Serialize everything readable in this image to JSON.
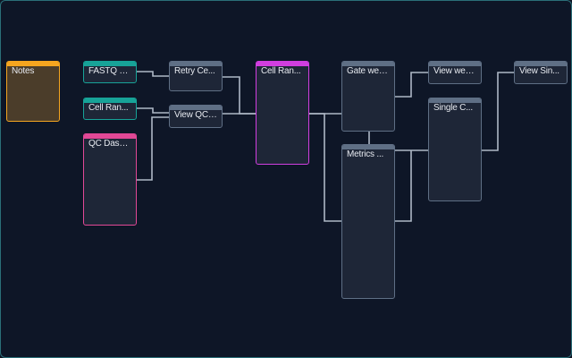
{
  "colors": {
    "background": "#0e1627",
    "canvas_border": "#2b6f78",
    "node_body": "#1e2637",
    "wire": "#aeb8c6"
  },
  "nodes": [
    {
      "id": "notes",
      "title": "Notes",
      "color": "#f5a51f",
      "kind": "note"
    },
    {
      "id": "fastq",
      "title": "FASTQ Di...",
      "color": "#17a398",
      "kind": "teal"
    },
    {
      "id": "cellran1",
      "title": "Cell Ran...",
      "color": "#17a398",
      "kind": "teal"
    },
    {
      "id": "qcdash",
      "title": "QC Dashb...",
      "color": "#e24896",
      "kind": "pink"
    },
    {
      "id": "retry",
      "title": "Retry Ce...",
      "color": "#5f6f85",
      "kind": "gray"
    },
    {
      "id": "viewqc",
      "title": "View QC ...",
      "color": "#5f6f85",
      "kind": "gray"
    },
    {
      "id": "cellran2",
      "title": "Cell Ran...",
      "color": "#d13ee0",
      "kind": "magenta"
    },
    {
      "id": "gate",
      "title": "Gate web...",
      "color": "#5f6f85",
      "kind": "gray"
    },
    {
      "id": "metrics",
      "title": "Metrics ...",
      "color": "#5f6f85",
      "kind": "gray"
    },
    {
      "id": "viewweb",
      "title": "View web...",
      "color": "#5f6f85",
      "kind": "gray"
    },
    {
      "id": "single",
      "title": "Single C...",
      "color": "#5f6f85",
      "kind": "gray"
    },
    {
      "id": "viewsin",
      "title": "View Sin...",
      "color": "#5f6f85",
      "kind": "gray"
    }
  ],
  "edges": [
    [
      "fastq",
      "retry"
    ],
    [
      "retry",
      "cellran2"
    ],
    [
      "cellran1",
      "viewqc"
    ],
    [
      "qcdash",
      "viewqc"
    ],
    [
      "viewqc",
      "cellran2"
    ],
    [
      "cellran2",
      "gate"
    ],
    [
      "cellran2",
      "metrics"
    ],
    [
      "gate",
      "viewweb"
    ],
    [
      "metrics",
      "single"
    ],
    [
      "single",
      "viewsin"
    ]
  ]
}
